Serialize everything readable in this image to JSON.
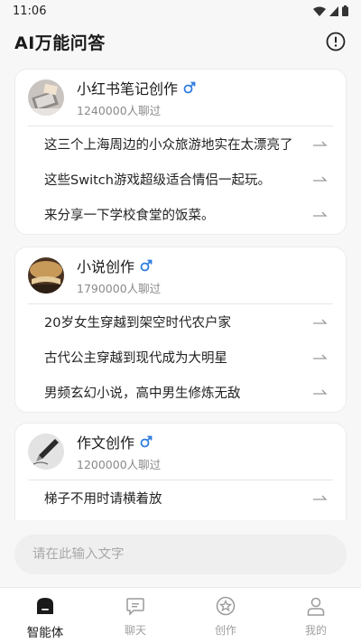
{
  "status_bar": {
    "time": "11:06",
    "icons": [
      "wifi-icon",
      "signal-icon",
      "battery-icon"
    ]
  },
  "header": {
    "title": "AI万能问答",
    "info_icon": "info-circle-icon"
  },
  "cards": [
    {
      "title": "小红书笔记创作",
      "gender_icon": "male-symbol-icon",
      "count": "1240000人聊过",
      "avatar": "notebook-laptop-image",
      "prompts": [
        "这三个上海周边的小众旅游地实在太漂亮了",
        "这些Switch游戏超级适合情侣一起玩。",
        "来分享一下学校食堂的饭菜。"
      ]
    },
    {
      "title": "小说创作",
      "gender_icon": "male-symbol-icon",
      "count": "1790000人聊过",
      "avatar": "open-book-image",
      "prompts": [
        "20岁女生穿越到架空时代农户家",
        "古代公主穿越到现代成为大明星",
        "男频玄幻小说，高中男生修炼无敌"
      ]
    },
    {
      "title": "作文创作",
      "gender_icon": "male-symbol-icon",
      "count": "1200000人聊过",
      "avatar": "fountain-pen-image",
      "prompts": [
        "梯子不用时请横着放"
      ]
    }
  ],
  "input": {
    "placeholder": "请在此输入文字"
  },
  "tabs": [
    {
      "label": "智能体",
      "icon": "agent-icon",
      "active": true
    },
    {
      "label": "聊天",
      "icon": "chat-bubble-icon",
      "active": false
    },
    {
      "label": "创作",
      "icon": "create-star-icon",
      "active": false
    },
    {
      "label": "我的",
      "icon": "profile-icon",
      "active": false
    }
  ],
  "colors": {
    "accent_blue": "#2f7de1",
    "active_tab": "#1a1a1a",
    "inactive_tab": "#a0a0a0"
  }
}
